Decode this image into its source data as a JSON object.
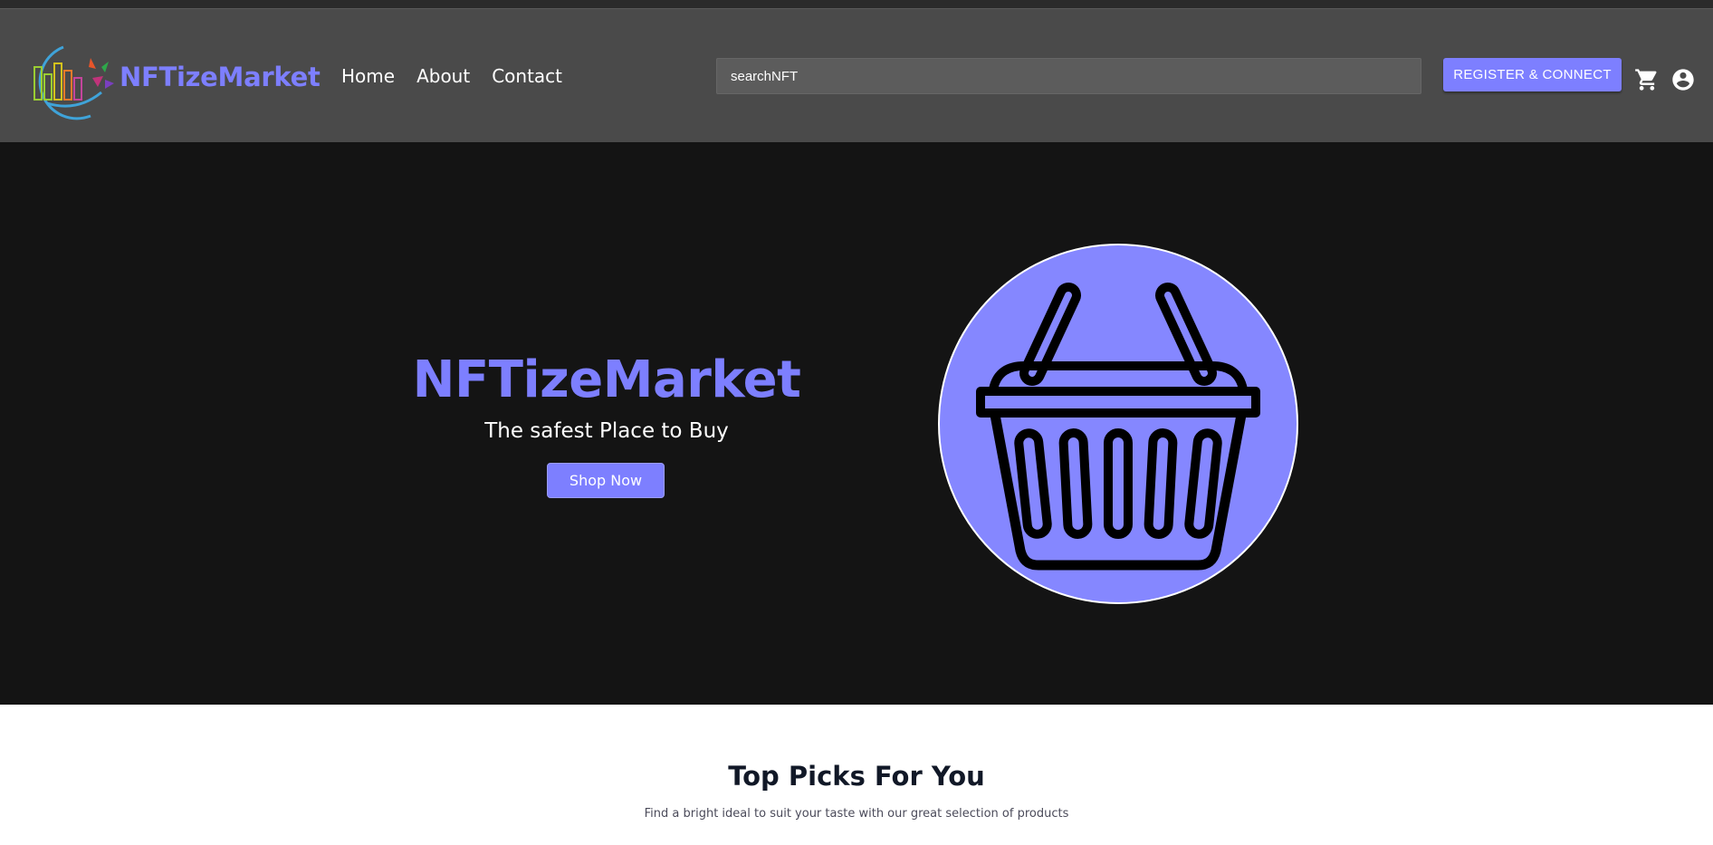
{
  "header": {
    "brand": "NFTizeMarket",
    "nav": [
      {
        "label": "Home"
      },
      {
        "label": "About"
      },
      {
        "label": "Contact"
      }
    ],
    "search": {
      "placeholder": "searchNFT"
    },
    "register_button": "REGISTER & CONNECT",
    "icons": [
      "logo-icon",
      "cart-icon",
      "account-icon"
    ]
  },
  "hero": {
    "title": "NFTizeMarket",
    "subtitle": "The safest Place to Buy",
    "cta": "Shop Now",
    "image_icon": "shopping-basket-icon"
  },
  "section": {
    "title": "Top Picks For You",
    "subtitle": "Find a bright ideal to suit your taste with our great selection of products"
  },
  "colors": {
    "accent": "#7d7fff",
    "navbar": "#4a4a4a",
    "hero_bg": "#141414"
  }
}
